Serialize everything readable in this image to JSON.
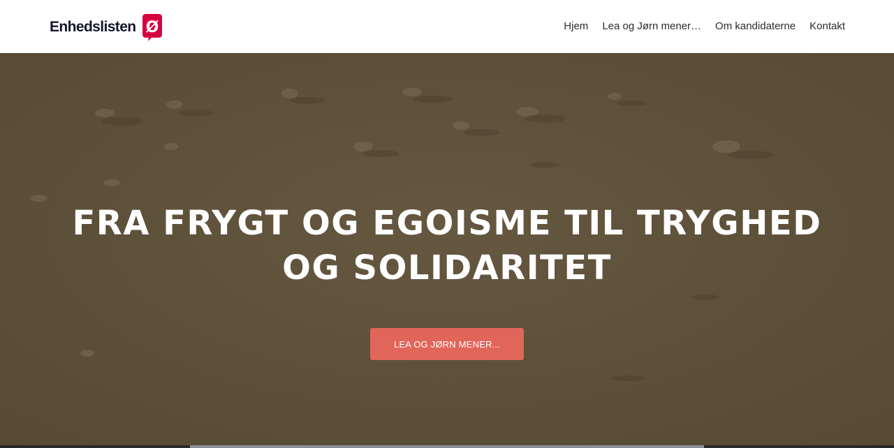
{
  "header": {
    "logo_text": "Enhedslisten",
    "logo_mark_glyph": "Ø",
    "brand_color": "#d6003f"
  },
  "nav": {
    "items": [
      {
        "label": "Hjem"
      },
      {
        "label": "Lea og Jørn mener…"
      },
      {
        "label": "Om kandidaterne"
      },
      {
        "label": "Kontakt"
      }
    ]
  },
  "hero": {
    "headline_line1": "FRA FRYGT OG EGOISME TIL TRYGHED",
    "headline_line2": "OG SOLIDARITET",
    "cta_label": "LEA OG JØRN MENER...",
    "cta_color": "#e2655a",
    "overlay_color": "#5d5038"
  }
}
